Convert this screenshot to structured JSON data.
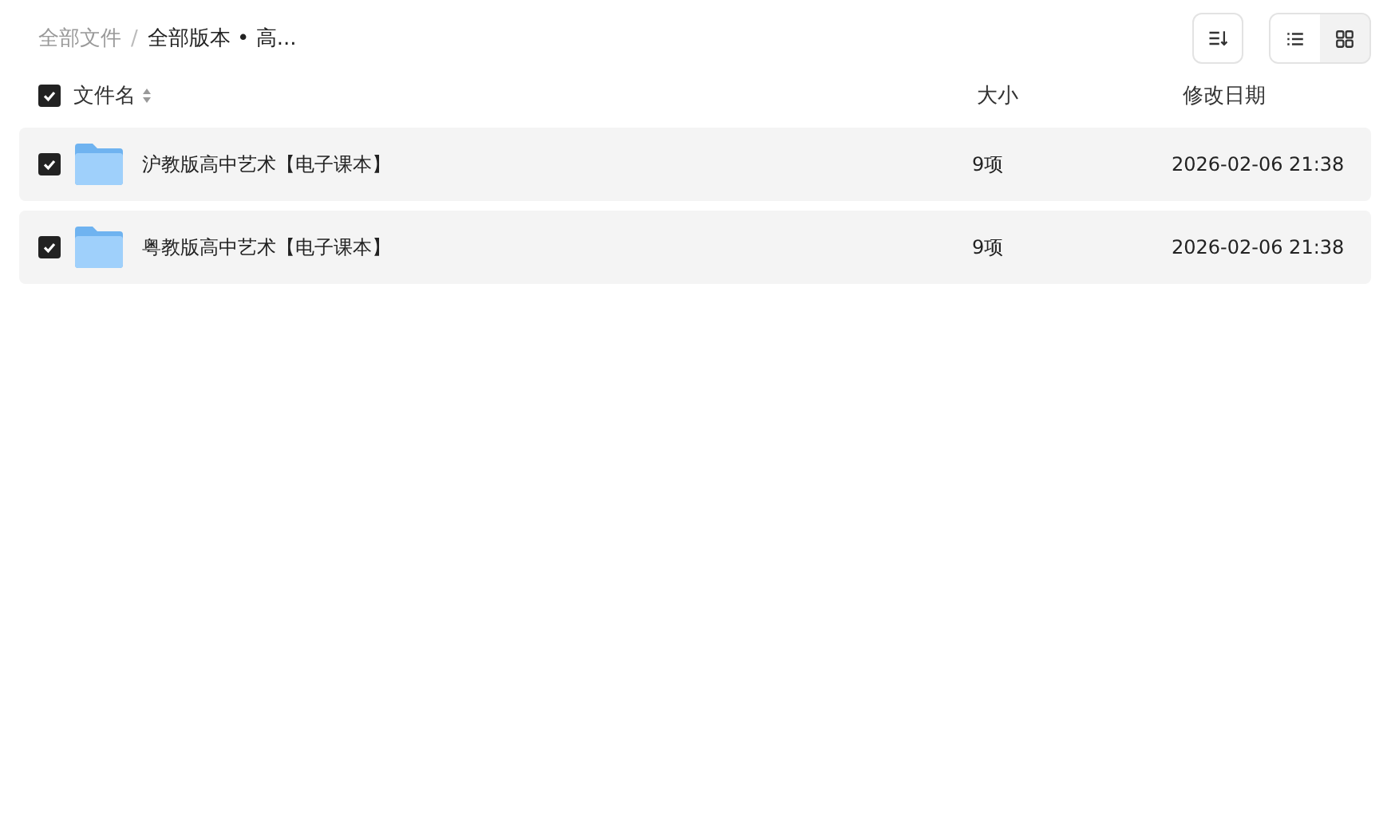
{
  "breadcrumb_separator": "/",
  "breadcrumb": [
    {
      "label": "全部文件",
      "current": false
    },
    {
      "label": "全部版本 • 高...",
      "current": true
    }
  ],
  "views": [
    {
      "kind": "list",
      "selected": true
    },
    {
      "kind": "grid",
      "selected": false
    }
  ],
  "header": {
    "checked": true,
    "name": "文件名",
    "size": "大小",
    "date": "修改日期"
  },
  "rows": [
    {
      "checked": true,
      "name": "沪教版高中艺术【电子课本】",
      "size": "9项",
      "date": "2026-02-06 21:38"
    },
    {
      "checked": true,
      "name": "粤教版高中艺术【电子课本】",
      "size": "9项",
      "date": "2026-02-06 21:38"
    }
  ]
}
